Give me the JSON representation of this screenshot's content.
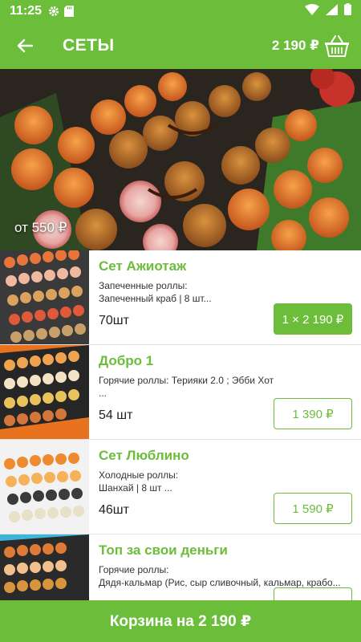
{
  "status_bar": {
    "time": "11:25"
  },
  "app_bar": {
    "title": "СЕТЫ",
    "cart_total": "2 190 ₽"
  },
  "hero": {
    "price_from": "от 550 ₽"
  },
  "products": [
    {
      "name": "Сет Ажиотаж",
      "desc": "Запеченные роллы:\nЗапеченный краб | 8 шт...",
      "qty": "70шт",
      "price": "1 × 2 190 ₽",
      "in_cart": true
    },
    {
      "name": "Добро 1",
      "desc": "Горячие роллы: Терияки 2.0 ; Эбби Хот\n...",
      "qty": "54 шт",
      "price": "1 390 ₽",
      "in_cart": false
    },
    {
      "name": "Сет Люблино",
      "desc": "Холодные роллы:\nШанхай | 8 шт ...",
      "qty": "46шт",
      "price": "1 590 ₽",
      "in_cart": false
    },
    {
      "name": "Топ за свои деньги",
      "desc": "Горячие роллы:\nДядя-кальмар (Рис, сыр сливочный, кальмар, крабо...",
      "qty": "",
      "price": "",
      "in_cart": false
    }
  ],
  "bottom_bar": {
    "label": "Корзина на 2 190 ₽"
  },
  "colors": {
    "accent": "#6bbd3a"
  }
}
